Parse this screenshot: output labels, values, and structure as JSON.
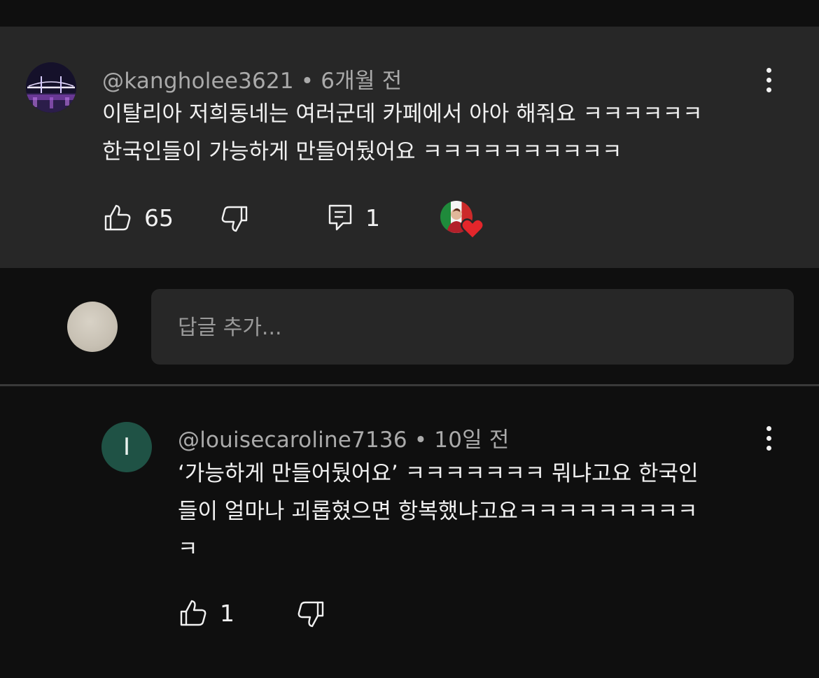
{
  "top_comment": {
    "author": "@kangholee3621",
    "time": "6개월 전",
    "lines": [
      "이탈리아 저희동네는 여러군데 카페에서 아아 해줘요 ㅋㅋㅋㅋㅋㅋ",
      "한국인들이 가능하게 만들어뒀어요 ㅋㅋㅋㅋㅋㅋㅋㅋㅋㅋ"
    ],
    "likes": "65",
    "replies": "1"
  },
  "reply_input": {
    "placeholder": "답글 추가..."
  },
  "reply_comment": {
    "avatar_letter": "I",
    "author": "@louisecaroline7136",
    "time": "10일 전",
    "lines": [
      "‘가능하게 만들어뒀어요’ ㅋㅋㅋㅋㅋㅋㅋ 뭐냐고요 한국인",
      "들이 얼마나 괴롭혔으면 항복했냐고요ㅋㅋㅋㅋㅋㅋㅋㅋㅋ",
      "ㅋ"
    ],
    "likes": "1"
  },
  "separator": "•",
  "colors": {
    "background": "#0f0f0f",
    "card": "#272727",
    "text": "#f1f1f1",
    "meta": "#aaaaaa",
    "reply_avatar": "#1f5245",
    "heart": "#e3262b"
  },
  "icons": [
    "thumbs-up-icon",
    "thumbs-down-icon",
    "reply-icon",
    "more-vert-icon",
    "heart-icon"
  ]
}
